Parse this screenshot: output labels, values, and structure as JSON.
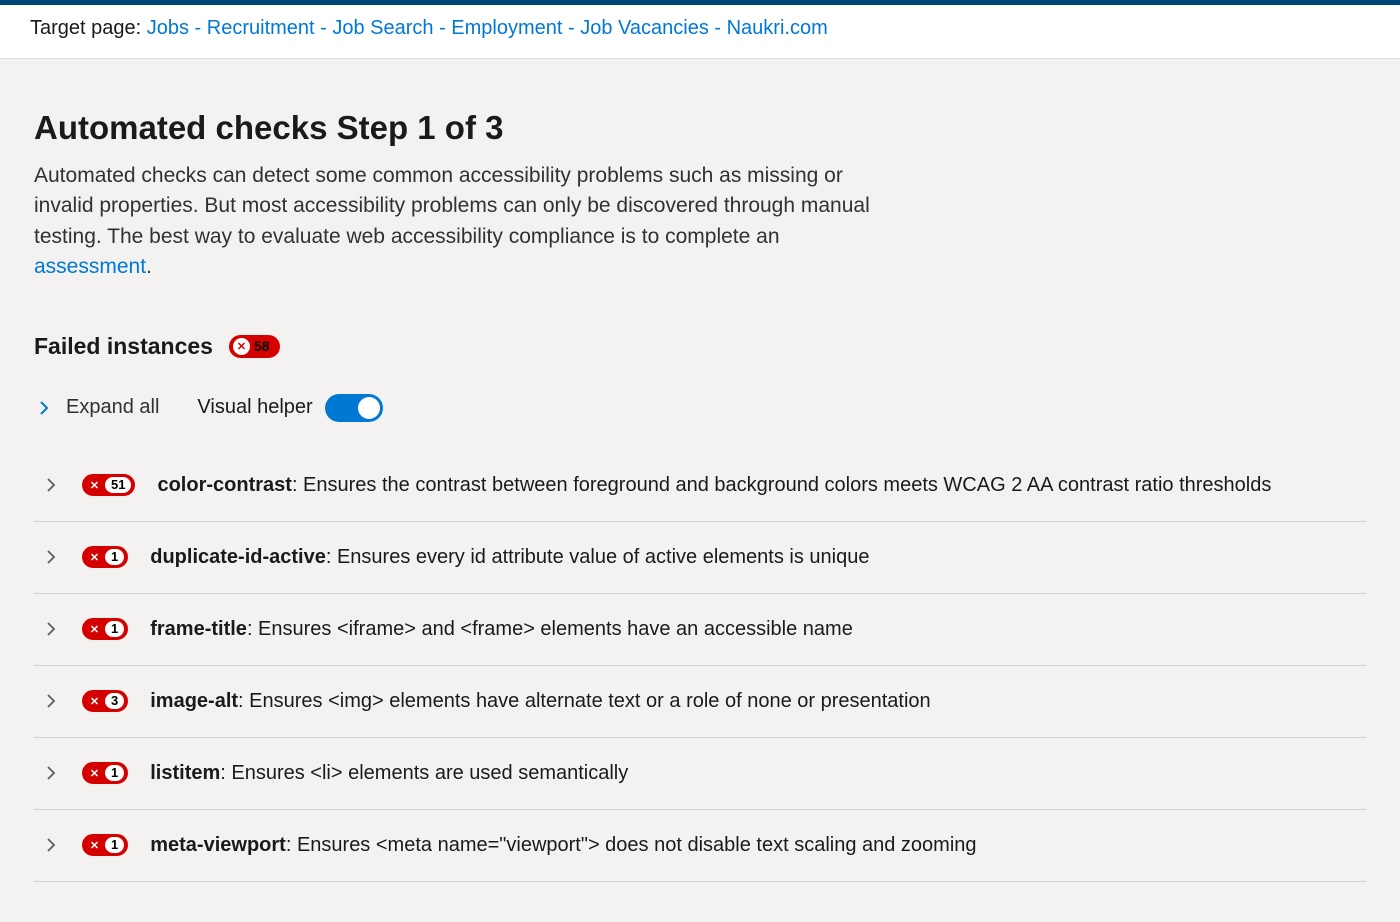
{
  "target": {
    "label": "Target page: ",
    "linkText": "Jobs - Recruitment - Job Search - Employment - Job Vacancies - Naukri.com"
  },
  "page": {
    "title": "Automated checks Step 1 of 3",
    "descriptionPrefix": "Automated checks can detect some common accessibility problems such as missing or invalid properties. But most accessibility problems can only be discovered through manual testing. The best way to evaluate web accessibility compliance is to complete an ",
    "assessmentLink": "assessment",
    "descriptionSuffix": "."
  },
  "failed": {
    "heading": "Failed instances",
    "totalCount": "58",
    "xGlyph": "✕"
  },
  "toolbar": {
    "expandAll": "Expand all",
    "visualHelper": "Visual helper",
    "visualHelperOn": true
  },
  "rules": [
    {
      "count": "51",
      "name": "color-contrast",
      "desc": ": Ensures the contrast between foreground and background colors meets WCAG 2 AA contrast ratio thresholds"
    },
    {
      "count": "1",
      "name": "duplicate-id-active",
      "desc": ": Ensures every id attribute value of active elements is unique"
    },
    {
      "count": "1",
      "name": "frame-title",
      "desc": ": Ensures <iframe> and <frame> elements have an accessible name"
    },
    {
      "count": "3",
      "name": "image-alt",
      "desc": ": Ensures <img> elements have alternate text or a role of none or presentation"
    },
    {
      "count": "1",
      "name": "listitem",
      "desc": ": Ensures <li> elements are used semantically"
    },
    {
      "count": "1",
      "name": "meta-viewport",
      "desc": ": Ensures <meta name=\"viewport\"> does not disable text scaling and zooming"
    }
  ]
}
